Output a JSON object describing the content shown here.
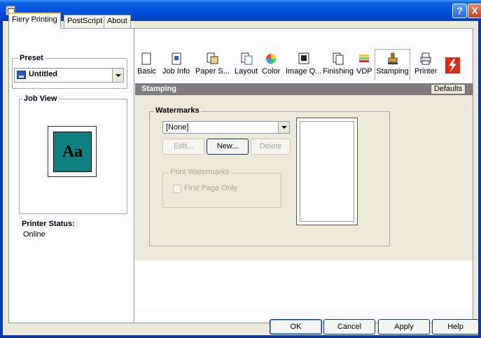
{
  "window": {
    "help_button": "?",
    "close_button": "X"
  },
  "tabs": [
    {
      "label": "Fiery Printing",
      "active": true
    },
    {
      "label": "PostScript",
      "active": false
    },
    {
      "label": "About",
      "active": false
    }
  ],
  "left": {
    "preset_title": "Preset",
    "preset_value": "Untitled",
    "jobview_title": "Job View",
    "jobview_sample": "Aa",
    "status_label": "Printer Status:",
    "status_value": "Online"
  },
  "toolbar": {
    "items": [
      {
        "label": "Basic",
        "icon": "page-icon"
      },
      {
        "label": "Job Info",
        "icon": "job-info-icon"
      },
      {
        "label": "Paper S...",
        "icon": "paper-source-icon"
      },
      {
        "label": "Layout",
        "icon": "layout-icon"
      },
      {
        "label": "Color",
        "icon": "color-wheel-icon"
      },
      {
        "label": "Image Q...",
        "icon": "image-quality-icon"
      },
      {
        "label": "Finishing",
        "icon": "finishing-icon"
      },
      {
        "label": "VDP",
        "icon": "vdp-icon"
      },
      {
        "label": "Stamping",
        "icon": "stamp-icon",
        "active": true
      },
      {
        "label": "Printer",
        "icon": "printer-icon"
      }
    ],
    "brand_logo": "fiery"
  },
  "section": {
    "title": "Stamping",
    "defaults_label": "Defaults"
  },
  "watermarks": {
    "title": "Watermarks",
    "selected": "[None]",
    "edit_label": "Edit...",
    "new_label": "New...",
    "delete_label": "Delete",
    "print_group_title": "Print Watermarks",
    "first_page_only_label": "First Page Only",
    "first_page_only_checked": false
  },
  "footer": {
    "ok_label": "OK",
    "cancel_label": "Cancel",
    "apply_label": "Apply",
    "help_label": "Help"
  }
}
